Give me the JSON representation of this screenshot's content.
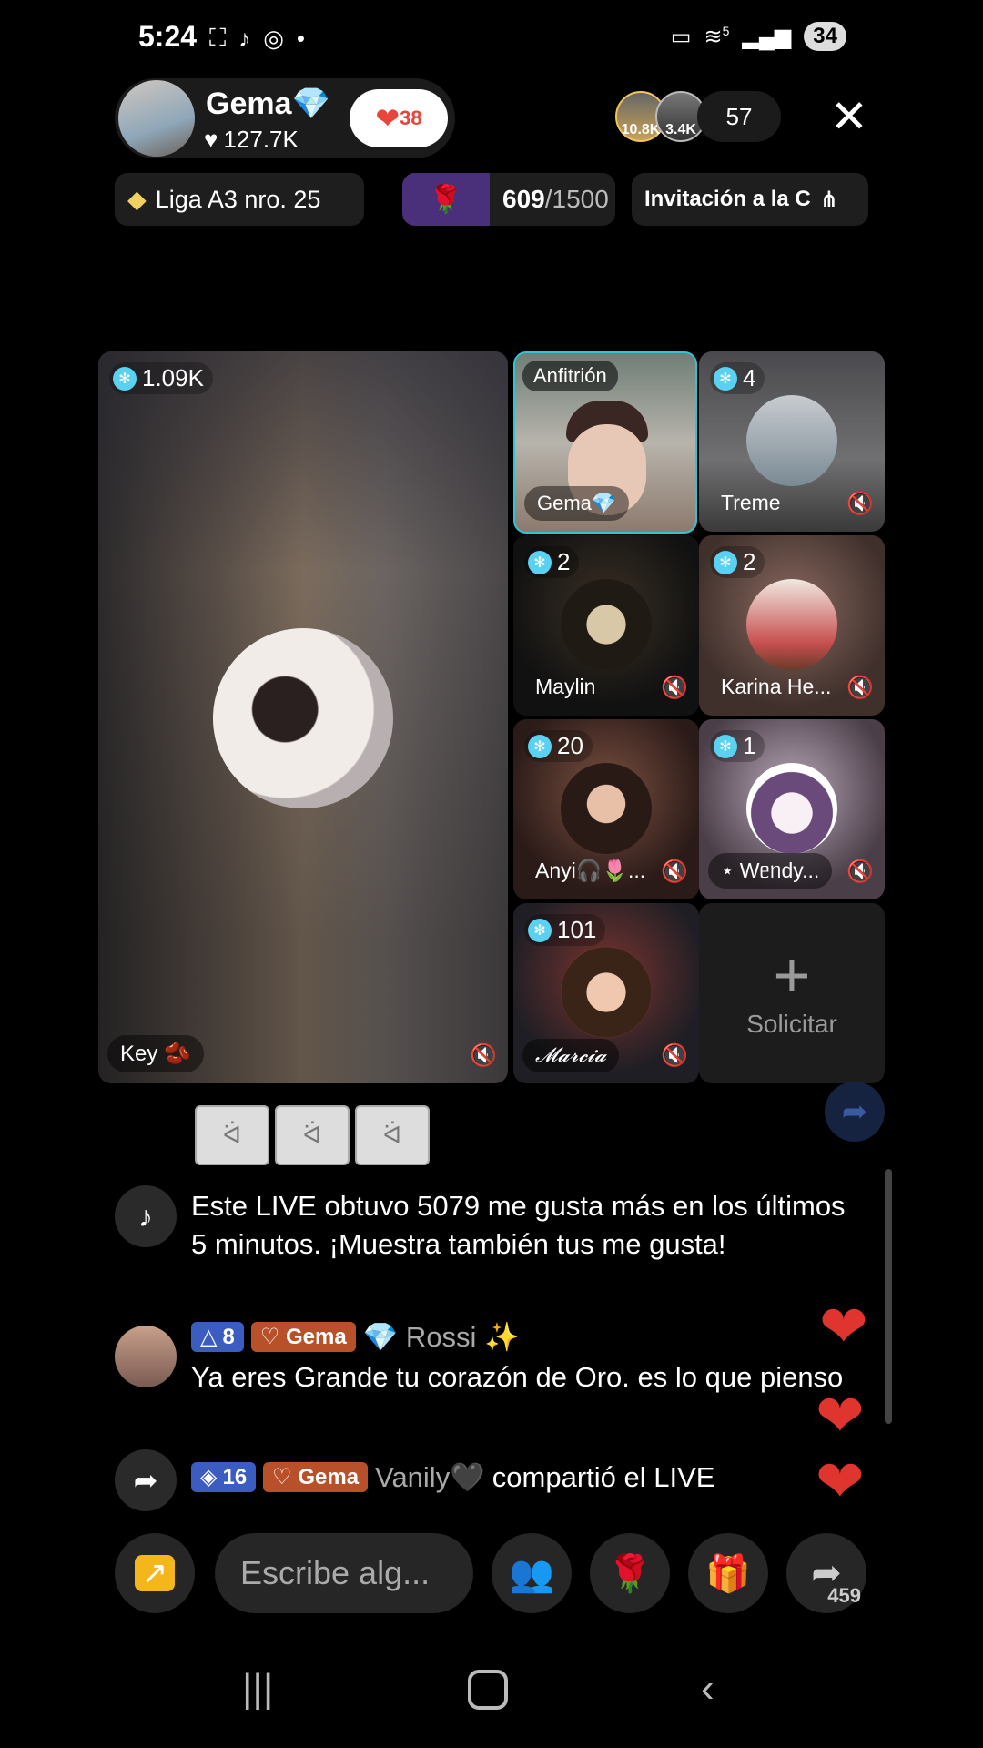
{
  "status_bar": {
    "time": "5:24",
    "battery": "34",
    "signal_label": "5"
  },
  "host": {
    "name": "Gema💎",
    "likes": "127.7K",
    "badge_count": "38"
  },
  "viewers": {
    "top1": "10.8K",
    "top2": "3.4K",
    "count": "57"
  },
  "chips": {
    "league": "Liga A3 nro. 25",
    "rose_current": "609",
    "rose_goal": "/1500",
    "rose_progress": 0.406,
    "invite": "Invitación a la C"
  },
  "grid": {
    "main": {
      "gift_count": "1.09K",
      "name": "Key 🫘"
    },
    "host_tile": {
      "label": "Anfitrión",
      "name": "Gema💎"
    },
    "tiles": [
      {
        "count": "4",
        "name": "Treme"
      },
      {
        "count": "2",
        "name": "Maylin"
      },
      {
        "count": "2",
        "name": "Karina He..."
      },
      {
        "count": "20",
        "name": "Anyi🎧🌷..."
      },
      {
        "count": "1",
        "name": "⋆ Wᥱᥒdy..."
      },
      {
        "count": "101",
        "name": "𝓜𝓪𝓻𝓬𝓲𝓪"
      }
    ],
    "request": {
      "plus": "+",
      "label": "Solicitar"
    }
  },
  "chat": {
    "system_msg": "Este LIVE obtuvo 5079 me gusta más en los últimos 5 minutos. ¡Muestra también tus me gusta!",
    "msg2": {
      "level": "8",
      "fan_badge": "Gema",
      "user": "💎 Rossi ✨",
      "text": "Ya eres Grande tu corazón de Oro. es lo que pienso"
    },
    "msg3": {
      "level": "16",
      "fan_badge": "Gema",
      "user": "Vanily🖤",
      "text": "compartió el LIVE"
    }
  },
  "bottom_bar": {
    "input_placeholder": "Escribe alg...",
    "share_count": "459"
  },
  "colors": {
    "accent_cyan": "#2ec4d6",
    "heart": "#e0342e",
    "rose_fill": "#4a2f7a",
    "level_badge": "#3b5cc0",
    "fan_badge": "#b8502a"
  }
}
